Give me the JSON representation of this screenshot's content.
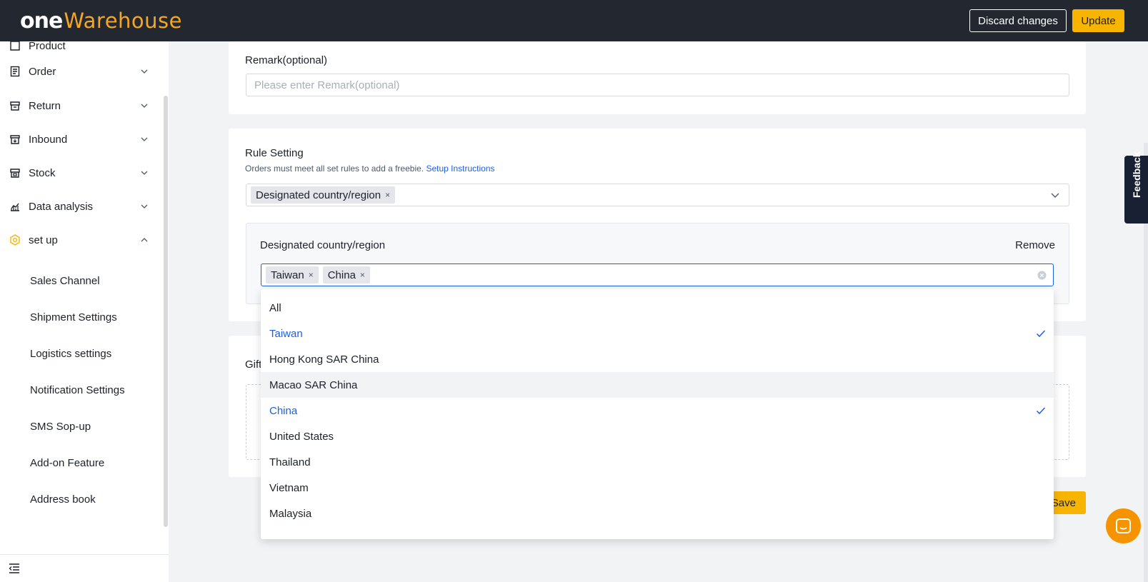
{
  "header": {
    "logo_one": "one",
    "logo_warehouse": "Warehouse",
    "discard_label": "Discard changes",
    "update_label": "Update"
  },
  "sidebar": {
    "partial_item": "Product",
    "items": [
      {
        "label": "Order",
        "icon": "order-icon"
      },
      {
        "label": "Return",
        "icon": "return-icon"
      },
      {
        "label": "Inbound",
        "icon": "inbound-icon"
      },
      {
        "label": "Stock",
        "icon": "stock-icon"
      },
      {
        "label": "Data analysis",
        "icon": "chart-icon"
      },
      {
        "label": "set up",
        "icon": "setup-icon"
      }
    ],
    "subitems": [
      "Sales Channel",
      "Shipment Settings",
      "Logistics settings",
      "Notification Settings",
      "SMS Sop-up",
      "Add-on Feature",
      "Address book"
    ]
  },
  "remark": {
    "label": "Remark(optional)",
    "placeholder": "Please enter Remark(optional)"
  },
  "rule": {
    "title": "Rule Setting",
    "desc": "Orders must meet all set rules to add a freebie.",
    "link": "Setup Instructions",
    "selected_tag": "Designated country/region",
    "box_title": "Designated country/region",
    "remove_label": "Remove",
    "tags": [
      "Taiwan",
      "China"
    ]
  },
  "gift": {
    "label_partial": "Gift"
  },
  "dropdown": {
    "options": [
      {
        "label": "All",
        "selected": false
      },
      {
        "label": "Taiwan",
        "selected": true
      },
      {
        "label": "Hong Kong SAR China",
        "selected": false
      },
      {
        "label": "Macao SAR China",
        "selected": false,
        "hovered": true
      },
      {
        "label": "China",
        "selected": true
      },
      {
        "label": "United States",
        "selected": false
      },
      {
        "label": "Thailand",
        "selected": false
      },
      {
        "label": "Vietnam",
        "selected": false
      },
      {
        "label": "Malaysia",
        "selected": false
      }
    ]
  },
  "footer": {
    "save_label": "Save"
  },
  "feedback": "Feedback",
  "colors": {
    "accent": "#f7b500",
    "link": "#1d5fe5",
    "topbar": "#232730"
  }
}
